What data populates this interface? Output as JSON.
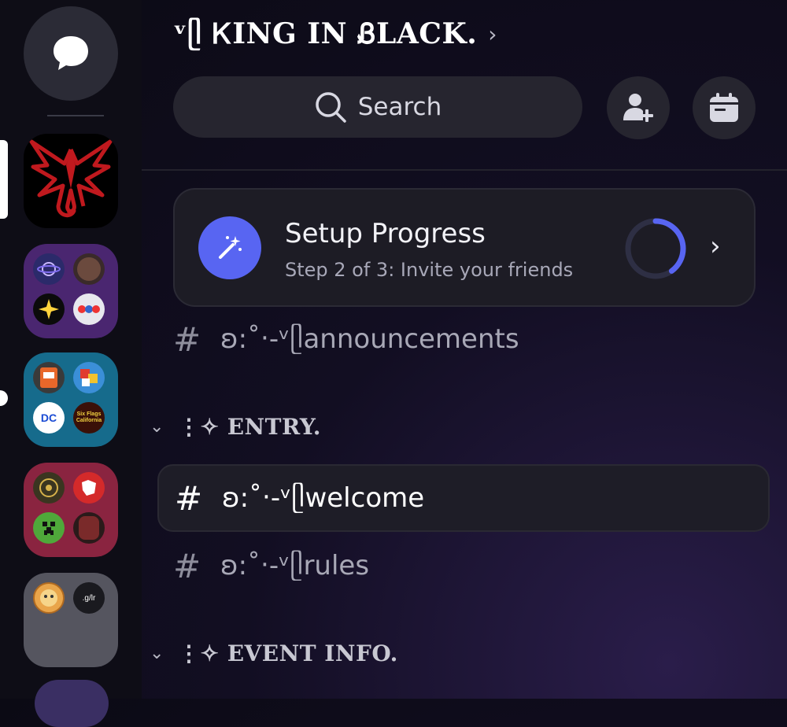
{
  "server": {
    "name": "ᵛᥫ ᏦING IN ᏰLACK.",
    "chevron": "›"
  },
  "header": {
    "search_label": "Search"
  },
  "guild_rail": {
    "folder_labels": {
      "six_flags": "Six Flags California",
      "gl": ".g/lr",
      "dc": "DC"
    }
  },
  "setup_progress": {
    "title": "Setup Progress",
    "subtitle": "Step 2 of 3: Invite your friends",
    "fraction_complete": 0.4,
    "accent": "#5865f2"
  },
  "channels": {
    "announcements": "ʚ:˚‧-ᵛᥫannouncements",
    "welcome": "ʚ:˚‧-ᵛᥫwelcome",
    "rules": "ʚ:˚‧-ᵛᥫrules"
  },
  "categories": {
    "entry": "⋮✧ ENTRY.",
    "event_info": "⋮✧ EVENT INFO."
  },
  "glyphs": {
    "hash": "#",
    "chevron_down": "⌄",
    "chevron_right": "›"
  }
}
